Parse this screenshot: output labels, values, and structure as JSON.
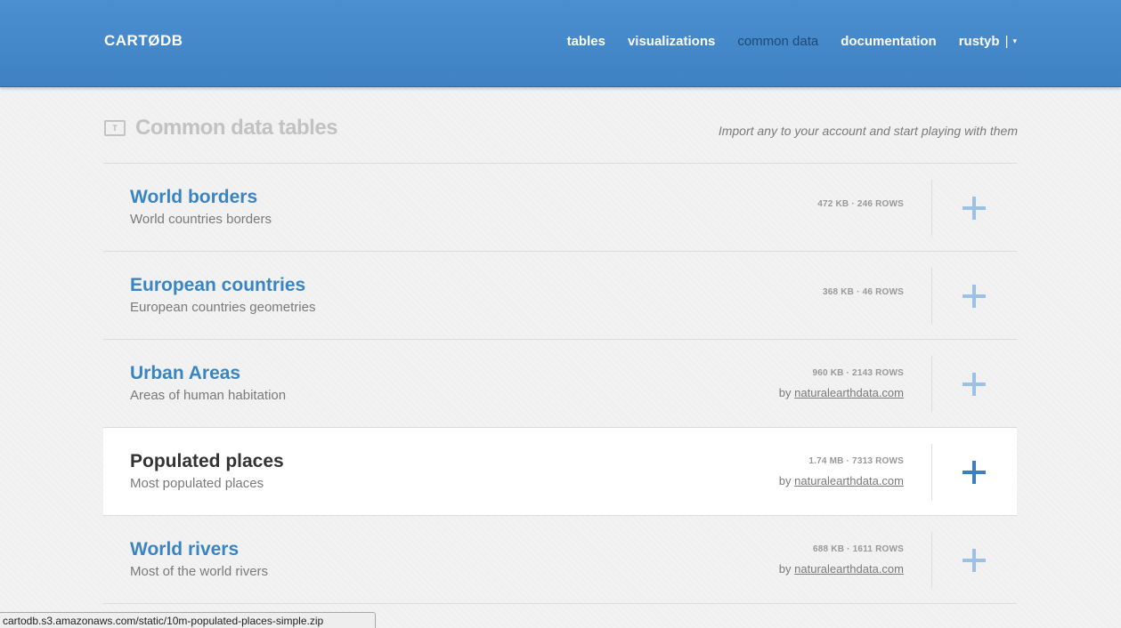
{
  "header": {
    "logo": "CARTØDB",
    "nav": {
      "tables": "tables",
      "visualizations": "visualizations",
      "common_data": "common data",
      "documentation": "documentation",
      "user": "rustyb",
      "separator": "|",
      "caret": "▾"
    },
    "accent": "#4a8fd0"
  },
  "page": {
    "icon_letter": "T",
    "title": "Common data tables",
    "subtitle": "Import any to your account and start playing with them"
  },
  "tables": [
    {
      "title": "World borders",
      "description": "World countries borders",
      "size": "472 KB · 246 ROWS",
      "source_prefix": "",
      "source_link": ""
    },
    {
      "title": "European countries",
      "description": "European countries geometries",
      "size": "368 KB · 46 ROWS",
      "source_prefix": "",
      "source_link": ""
    },
    {
      "title": "Urban Areas",
      "description": "Areas of human habitation",
      "size": "960 KB · 2143 ROWS",
      "source_prefix": "by",
      "source_link": "naturalearthdata.com"
    },
    {
      "title": "Populated places",
      "description": "Most populated places",
      "size": "1.74 MB · 7313 ROWS",
      "source_prefix": "by",
      "source_link": "naturalearthdata.com"
    },
    {
      "title": "World rivers",
      "description": "Most of the world rivers",
      "size": "688 KB · 1611 ROWS",
      "source_prefix": "by",
      "source_link": "naturalearthdata.com"
    }
  ],
  "statusbar": {
    "url": "cartodb.s3.amazonaws.com/static/10m-populated-places-simple.zip"
  }
}
